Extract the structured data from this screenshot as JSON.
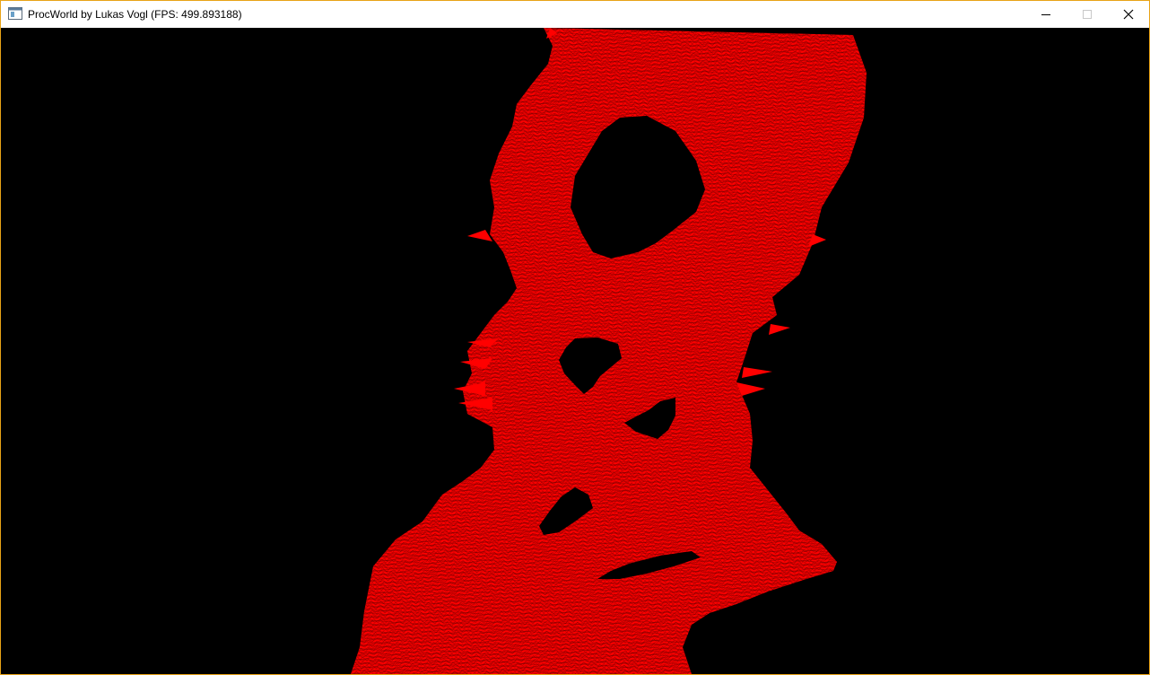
{
  "window": {
    "title": "ProcWorld by Lukas Vogl (FPS: 499.893188)",
    "icon": "application-window-icon",
    "controls": {
      "minimize": "minimize-icon",
      "maximize": "maximize-icon",
      "close": "close-icon"
    },
    "border_color": "#e8a317"
  },
  "viewport": {
    "background_color": "#000000",
    "mesh_color": "#ff0000",
    "render_mode": "wireframe"
  }
}
